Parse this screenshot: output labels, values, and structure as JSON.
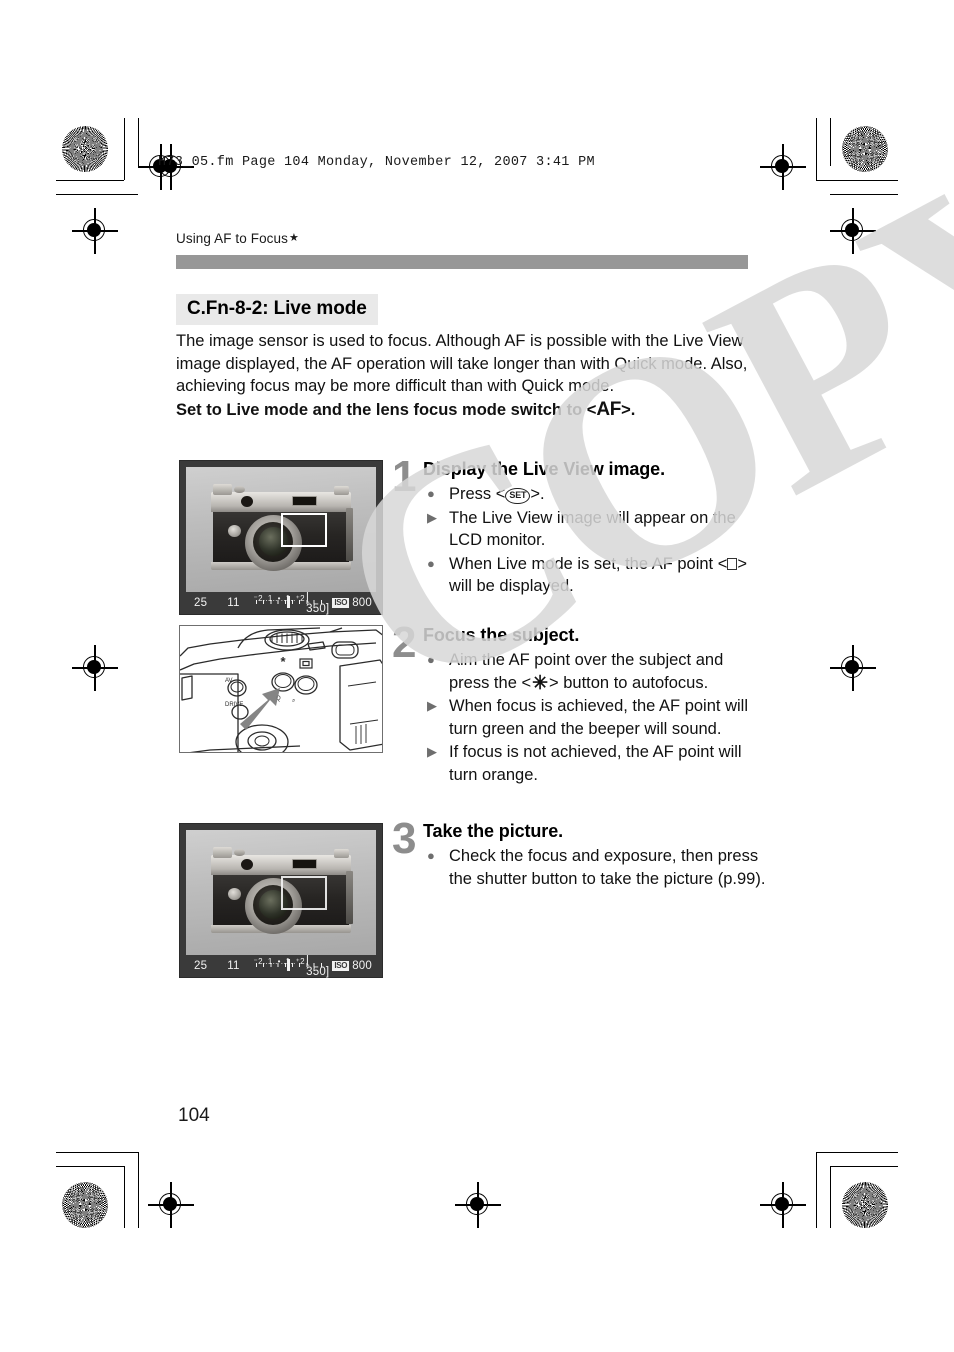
{
  "print_header": "H73_05.fm  Page 104  Monday, November 12, 2007  3:41 PM",
  "running_head": {
    "text": "Using AF to Focus",
    "star": "★"
  },
  "section": {
    "heading": "C.Fn-8-2: Live mode",
    "intro_paragraph": "The image sensor is used to focus. Although AF is possible with the Live View image displayed, the AF operation will take longer than with Quick mode. Also, achieving focus may be more difficult than with Quick mode.",
    "intro_bold_prefix": "Set to Live mode and the lens focus mode switch to <",
    "intro_bold_icon": "AF",
    "intro_bold_suffix": ">."
  },
  "steps": [
    {
      "number": "1",
      "title": "Display the Live View image.",
      "bullets": [
        {
          "marker": "dot",
          "prefix": "Press <",
          "icon": "SET",
          "suffix": ">."
        },
        {
          "marker": "tri",
          "text": "The Live View image will appear on the LCD monitor."
        },
        {
          "marker": "dot",
          "prefix": "When Live mode is set, the AF point <",
          "icon": "SQUARE",
          "suffix": "> will be displayed."
        }
      ]
    },
    {
      "number": "2",
      "title": "Focus the subject.",
      "bullets": [
        {
          "marker": "dot",
          "prefix": "Aim the AF point over the subject and press the <",
          "icon": "AE_LOCK",
          "suffix": "> button to autofocus."
        },
        {
          "marker": "tri",
          "text": "When focus is achieved, the AF point will turn green and the beeper will sound."
        },
        {
          "marker": "tri",
          "text": "If focus is not achieved, the AF point will turn orange."
        }
      ]
    },
    {
      "number": "3",
      "title": "Take the picture.",
      "bullets": [
        {
          "marker": "dot",
          "text": "Check the focus and exposure, then press the shutter button to take the picture (p.99)."
        }
      ]
    }
  ],
  "lcd_status": {
    "shutter_speed": "25",
    "aperture": "11",
    "scale_labels": "⁻2..1..•..1..⁺2",
    "shots_remaining": "[ 350]",
    "iso_icon_label": "ISO",
    "iso_value": "800"
  },
  "figures": {
    "figure1_caption": "Live View image with AF point frame",
    "figure2_caption": "Camera back showing AE lock button",
    "figure3_caption": "Live View image after focus achieved"
  },
  "watermark": "COPY",
  "page_number": "104",
  "colors": {
    "gray_bar": "#979797",
    "heading_bg": "#e9e9e9",
    "step_number": "#8d8d8d",
    "watermark": "#d8d8d8",
    "lcd_bezel": "#3a3a3a"
  }
}
